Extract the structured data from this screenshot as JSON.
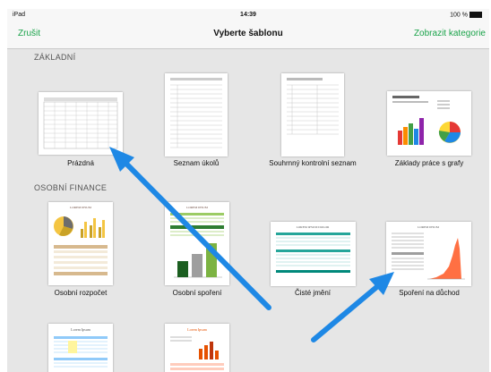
{
  "status_bar": {
    "device": "iPad",
    "time": "14:39",
    "battery": "100 %"
  },
  "nav": {
    "back_label": "Zrušit",
    "title": "Vyberte šablonu",
    "categories_label": "Zobrazit kategorie"
  },
  "sections": {
    "basic": "ZÁKLADNÍ",
    "personal_finance": "OSOBNÍ FINANCE"
  },
  "templates": {
    "blank": "Prázdná",
    "task_list": "Seznam úkolů",
    "checklist": "Souhrnný kontrolní seznam",
    "charts_basics": "Základy práce s grafy",
    "budget": "Osobní rozpočet",
    "savings": "Osobní spoření",
    "net_worth": "Čisté jmění",
    "retirement": "Spoření na důchod"
  },
  "thumb_text": {
    "budget_title": "LOREM IPSUM",
    "savings_title": "LOREM IPSUM",
    "net_worth_title": "LOREM IPSUM DOLOR",
    "retirement_title": "LOREM IPSUM",
    "row3a_title": "Lorem Ipsum",
    "row3b_title": "Lorem Ipsum"
  },
  "colors": {
    "accent": "#1aa34a",
    "arrow": "#1e88e5"
  }
}
